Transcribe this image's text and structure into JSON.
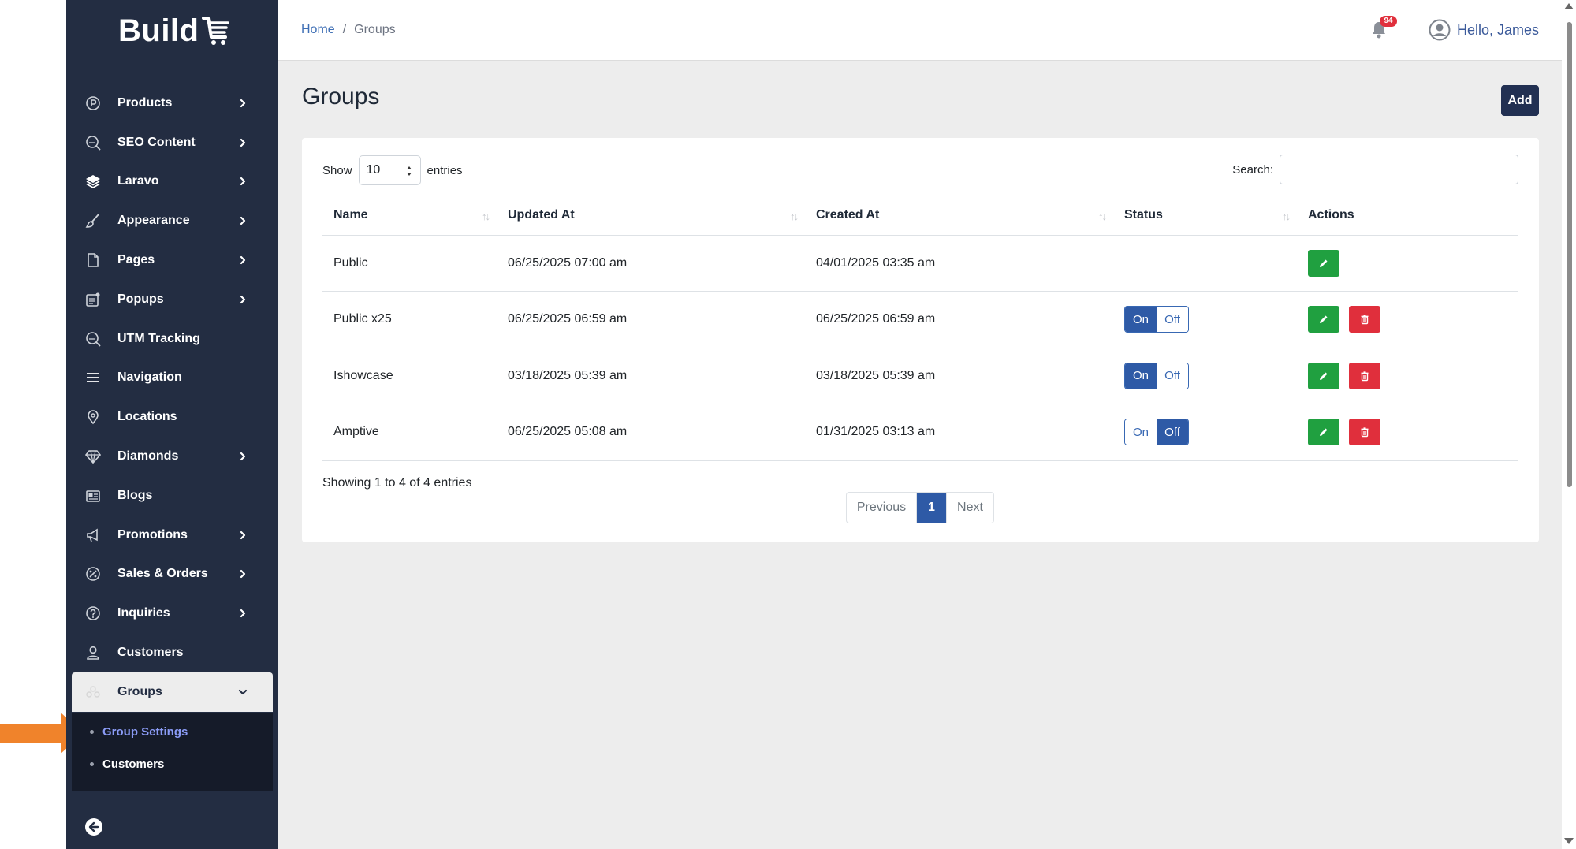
{
  "colors": {
    "sidebar_bg": "#232d42",
    "accent_blue": "#2e5aa6",
    "edit_green": "#20a040",
    "delete_red": "#e02f3c",
    "annotation_orange": "#f0832b"
  },
  "brand": {
    "name": "Build"
  },
  "sidebar": {
    "items": [
      {
        "label": "Products",
        "icon": "products-p-icon",
        "chevron": true
      },
      {
        "label": "SEO Content",
        "icon": "seo-icon",
        "chevron": true
      },
      {
        "label": "Laravo",
        "icon": "layers-icon",
        "chevron": true
      },
      {
        "label": "Appearance",
        "icon": "brush-icon",
        "chevron": true
      },
      {
        "label": "Pages",
        "icon": "page-icon",
        "chevron": true
      },
      {
        "label": "Popups",
        "icon": "popup-icon",
        "chevron": true
      },
      {
        "label": "UTM Tracking",
        "icon": "utm-icon",
        "chevron": false
      },
      {
        "label": "Navigation",
        "icon": "menu-icon",
        "chevron": false
      },
      {
        "label": "Locations",
        "icon": "location-pin-icon",
        "chevron": false
      },
      {
        "label": "Diamonds",
        "icon": "diamond-icon",
        "chevron": true
      },
      {
        "label": "Blogs",
        "icon": "newspaper-icon",
        "chevron": false
      },
      {
        "label": "Promotions",
        "icon": "megaphone-icon",
        "chevron": true
      },
      {
        "label": "Sales & Orders",
        "icon": "percent-icon",
        "chevron": true
      },
      {
        "label": "Inquiries",
        "icon": "question-icon",
        "chevron": true
      },
      {
        "label": "Customers",
        "icon": "user-icon",
        "chevron": false
      },
      {
        "label": "Groups",
        "icon": "groups-icon",
        "chevron": true,
        "active": true
      }
    ],
    "subitems": [
      {
        "label": "Group Settings",
        "active": true
      },
      {
        "label": "Customers",
        "active": false
      }
    ]
  },
  "topbar": {
    "breadcrumb": {
      "home": "Home",
      "separator": "/",
      "current": "Groups"
    },
    "notifications_count": "94",
    "greeting": "Hello, James"
  },
  "page": {
    "title": "Groups",
    "add_label": "Add",
    "show_label": "Show",
    "entries_value": "10",
    "entries_label": "entries",
    "search_label": "Search:",
    "search_value": "",
    "columns": [
      "Name",
      "Updated At",
      "Created At",
      "Status",
      "Actions"
    ],
    "rows": [
      {
        "name": "Public",
        "updated": "06/25/2025 07:00 am",
        "created": "04/01/2025 03:35 am",
        "status": null,
        "can_delete": false
      },
      {
        "name": "Public x25",
        "updated": "06/25/2025 06:59 am",
        "created": "06/25/2025 06:59 am",
        "status": "on",
        "can_delete": true
      },
      {
        "name": "Ishowcase",
        "updated": "03/18/2025 05:39 am",
        "created": "03/18/2025 05:39 am",
        "status": "on",
        "can_delete": true
      },
      {
        "name": "Amptive",
        "updated": "06/25/2025 05:08 am",
        "created": "01/31/2025 03:13 am",
        "status": "off",
        "can_delete": true
      }
    ],
    "toggle_on": "On",
    "toggle_off": "Off",
    "info": "Showing 1 to 4 of 4 entries",
    "pagination": {
      "previous": "Previous",
      "current": "1",
      "next": "Next"
    }
  }
}
